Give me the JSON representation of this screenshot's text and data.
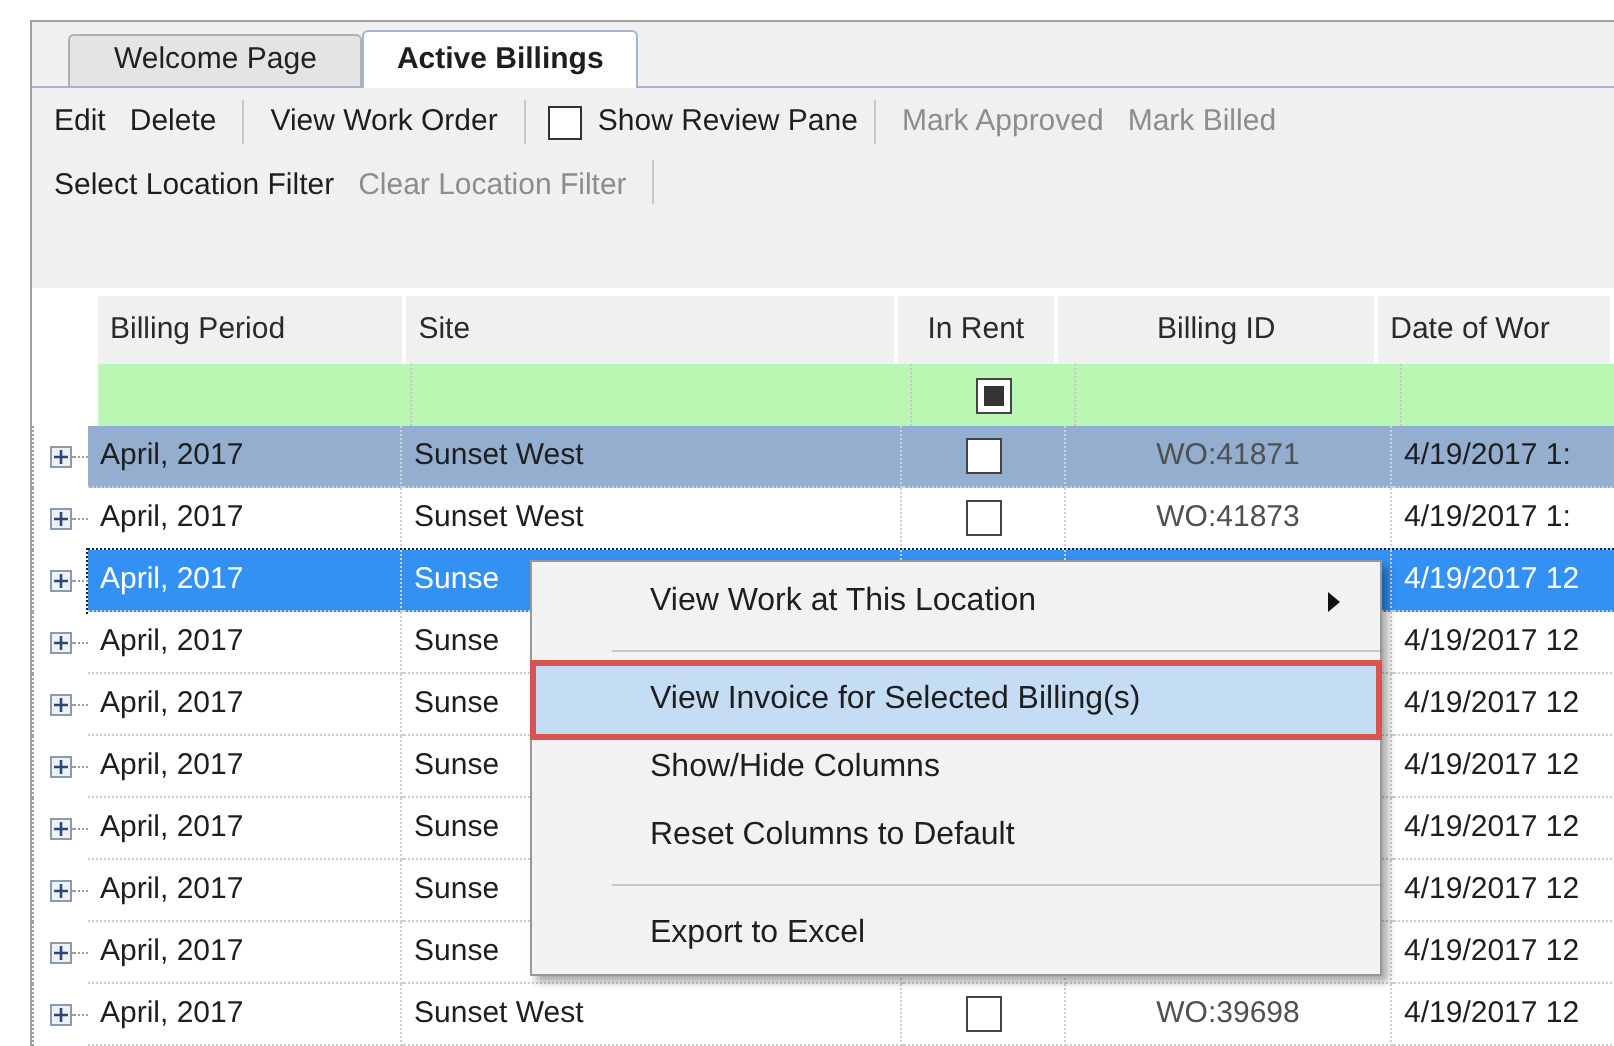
{
  "tabs": [
    {
      "label": "Welcome Page",
      "selected": false
    },
    {
      "label": "Active Billings",
      "selected": true
    }
  ],
  "toolbar": [
    {
      "kind": "button",
      "label": "Edit",
      "disabled": false
    },
    {
      "kind": "button",
      "label": "Delete",
      "disabled": false
    },
    {
      "kind": "separator"
    },
    {
      "kind": "button",
      "label": "View Work Order",
      "disabled": false
    },
    {
      "kind": "separator"
    },
    {
      "kind": "checkbox",
      "label": "Show Review Pane",
      "checked": false,
      "disabled": false
    },
    {
      "kind": "separator"
    },
    {
      "kind": "button",
      "label": "Mark Approved",
      "disabled": true
    },
    {
      "kind": "button",
      "label": "Mark Billed",
      "disabled": true
    }
  ],
  "filter_toolbar": [
    {
      "kind": "button",
      "label": "Select Location Filter",
      "disabled": false
    },
    {
      "kind": "button",
      "label": "Clear Location Filter",
      "disabled": true
    },
    {
      "kind": "separator"
    }
  ],
  "table": {
    "columns": [
      "Billing Period",
      "Site",
      "In Rent",
      "Billing ID",
      "Date of Wor"
    ],
    "filter_row": {
      "in_rent": true
    },
    "rows": [
      {
        "billing_period": "April, 2017",
        "site": "Sunset West",
        "in_rent": false,
        "billing_id": "WO:41871",
        "date": "4/19/2017 1:",
        "selected": false,
        "current": true
      },
      {
        "billing_period": "April, 2017",
        "site": "Sunset West",
        "in_rent": false,
        "billing_id": "WO:41873",
        "date": "4/19/2017 1:",
        "selected": false,
        "current": false
      },
      {
        "billing_period": "April, 2017",
        "site": "Sunse",
        "date": "4/19/2017 12",
        "selected": true,
        "current": false
      },
      {
        "billing_period": "April, 2017",
        "site": "Sunse",
        "date": "4/19/2017 12",
        "selected": false,
        "current": false
      },
      {
        "billing_period": "April, 2017",
        "site": "Sunse",
        "date": "4/19/2017 12",
        "selected": false,
        "current": false
      },
      {
        "billing_period": "April, 2017",
        "site": "Sunse",
        "date": "4/19/2017 12",
        "selected": false,
        "current": false
      },
      {
        "billing_period": "April, 2017",
        "site": "Sunse",
        "date": "4/19/2017 12",
        "selected": false,
        "current": false
      },
      {
        "billing_period": "April, 2017",
        "site": "Sunse",
        "date": "4/19/2017 12",
        "selected": false,
        "current": false
      },
      {
        "billing_period": "April, 2017",
        "site": "Sunse",
        "date": "4/19/2017 12",
        "selected": false,
        "current": false
      },
      {
        "billing_period": "April, 2017",
        "site": "Sunset West",
        "in_rent": false,
        "billing_id": "WO:39698",
        "date": "4/19/2017 12",
        "selected": false,
        "current": false
      }
    ]
  },
  "context_menu": [
    {
      "kind": "item",
      "label": "View Work at This Location",
      "submenu": true,
      "selected": false
    },
    {
      "kind": "separator"
    },
    {
      "kind": "item",
      "label": "View Invoice for Selected Billing(s)",
      "submenu": false,
      "selected": true
    },
    {
      "kind": "item",
      "label": "Show/Hide Columns",
      "submenu": false,
      "selected": false
    },
    {
      "kind": "item",
      "label": "Reset Columns to Default",
      "submenu": false,
      "selected": false
    },
    {
      "kind": "separator"
    },
    {
      "kind": "item",
      "label": "Export to Excel",
      "submenu": false,
      "selected": false
    }
  ]
}
